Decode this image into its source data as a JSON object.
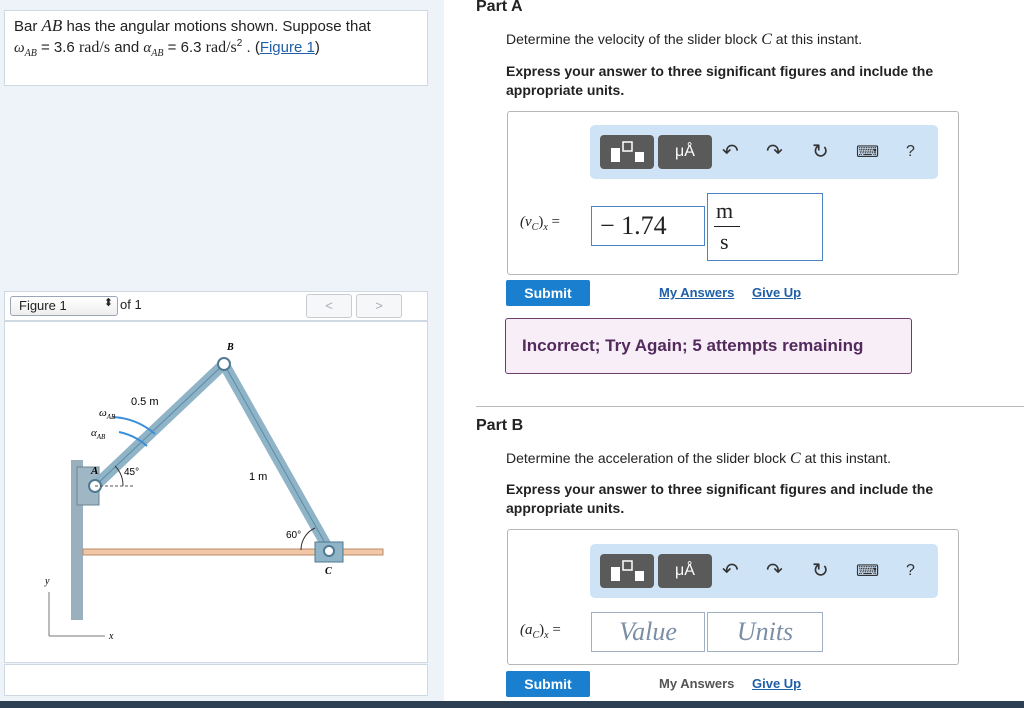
{
  "problem": {
    "line1_pre": "Bar ",
    "line1_var": "AB",
    "line1_post": " has the angular motions shown. Suppose that",
    "omega_sym": "ω",
    "omega_sub": "AB",
    "omega_value": " = 3.6 ",
    "omega_units": "rad/s",
    "and": " and ",
    "alpha_sym": "α",
    "alpha_sub": "AB",
    "alpha_value": " = 6.3 ",
    "alpha_units": "rad/s",
    "alpha_exp": "2",
    "sep": " . (",
    "figure_link": "Figure 1",
    "close": ")"
  },
  "figure_nav": {
    "select_label": "Figure 1",
    "of_text": "of 1",
    "prev": "<",
    "next": ">"
  },
  "figure": {
    "label_B": "B",
    "label_A": "A",
    "label_C": "C",
    "label_05m": "0.5 m",
    "label_1m": "1 m",
    "label_45": "45°",
    "label_60": "60°",
    "label_omega": "ω",
    "label_omega_sub": "AB",
    "label_alpha": "α",
    "label_alpha_sub": "AB",
    "label_y": "y",
    "label_x": "x"
  },
  "partA": {
    "title": "Part A",
    "question_pre": "Determine the velocity of the slider block ",
    "question_var": "C",
    "question_post": " at this instant.",
    "instruction": "Express your answer to three significant figures and include the appropriate units.",
    "toolbar": {
      "mu": "μÅ",
      "help": "?"
    },
    "field_var": "(v",
    "field_sub_c": "C",
    "field_close": ")",
    "field_sub_x": "x",
    "field_eq": " =",
    "value": "− 1.74",
    "units_num": "m",
    "units_den": "s",
    "submit": "Submit",
    "my_answers": "My Answers",
    "give_up": "Give Up",
    "feedback": "Incorrect; Try Again; 5 attempts remaining"
  },
  "partB": {
    "title": "Part B",
    "question_pre": "Determine the acceleration of the slider block ",
    "question_var": "C",
    "question_post": " at this instant.",
    "instruction": "Express your answer to three significant figures and include the appropriate units.",
    "toolbar": {
      "mu": "μÅ",
      "help": "?"
    },
    "field_var": "(a",
    "field_sub_c": "C",
    "field_close": ")",
    "field_sub_x": "x",
    "field_eq": " =",
    "value_placeholder": "Value",
    "units_placeholder": "Units",
    "submit": "Submit",
    "my_answers": "My Answers",
    "give_up": "Give Up"
  },
  "colors": {
    "submit": "#1b7fd0",
    "link": "#1f5fa8",
    "feedback_border": "#6c3d6c",
    "toolbar": "#cfe3f7"
  }
}
